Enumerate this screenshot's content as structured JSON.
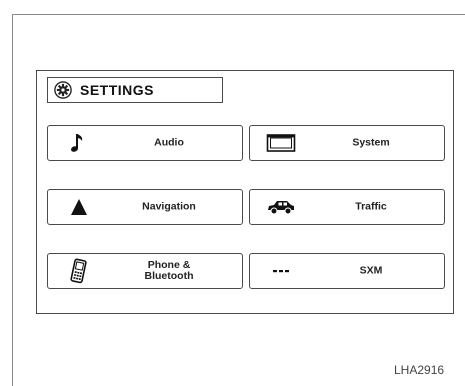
{
  "header": {
    "title": "SETTINGS",
    "icon": "gear-icon"
  },
  "tiles": [
    {
      "label": "Audio",
      "icon": "music-note-icon"
    },
    {
      "label": "System",
      "icon": "screen-icon"
    },
    {
      "label": "Navigation",
      "icon": "navigation-arrow-icon"
    },
    {
      "label": "Traffic",
      "icon": "car-icon"
    },
    {
      "label": "Phone &\nBluetooth",
      "icon": "phone-icon"
    },
    {
      "label": "SXM",
      "icon": "sxm-icon"
    }
  ],
  "figure_code": "LHA2916"
}
